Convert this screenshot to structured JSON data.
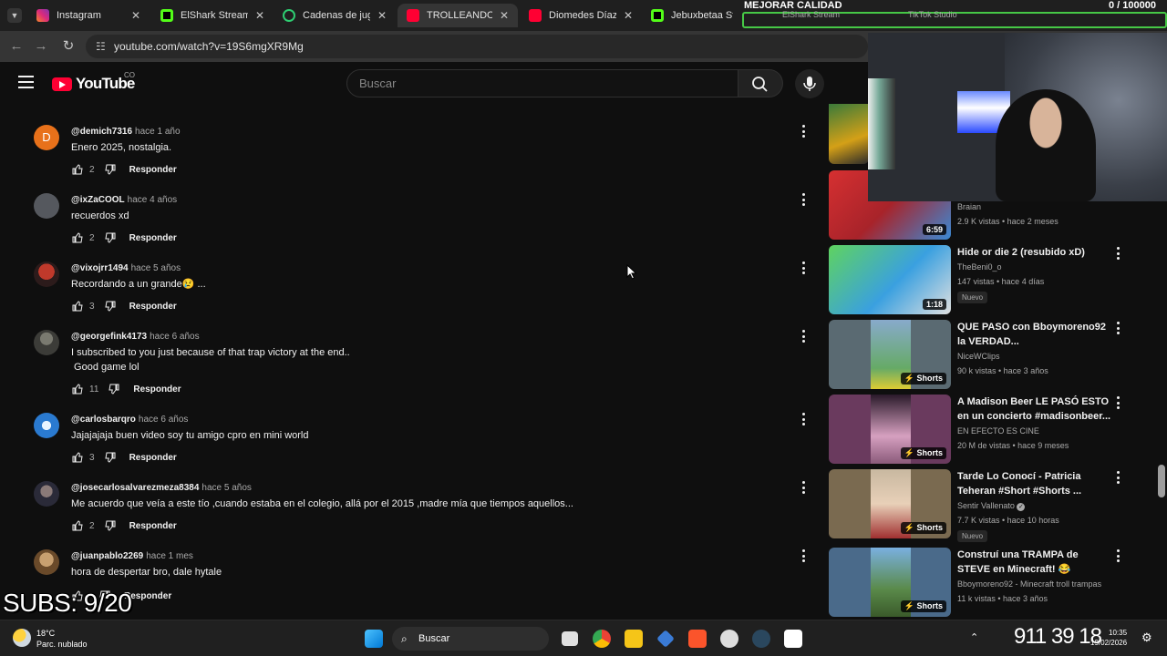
{
  "browser": {
    "tabs": [
      {
        "label": "Instagram",
        "color": "#d62976",
        "active": false
      },
      {
        "label": "ElShark Stream - V",
        "color": "#53fc18",
        "active": false
      },
      {
        "label": "Cadenas de jugad",
        "color": "#2ecc71",
        "active": false
      },
      {
        "label": "TROLLEANDO AF",
        "color": "#ff0033",
        "active": true
      },
      {
        "label": "Diomedes Díaz - T",
        "color": "#ff0033",
        "active": false
      },
      {
        "label": "Jebuxbetaa Strean",
        "color": "#53fc18",
        "active": false
      }
    ],
    "url": "youtube.com/watch?v=19S6mgXR9Mg"
  },
  "youtube": {
    "logo_word": "YouTube",
    "country": "CO",
    "search_placeholder": "Buscar"
  },
  "comments": [
    {
      "handle": "@demich7316",
      "ago": "hace 1 año",
      "text": "Enero 2025, nostalgia.",
      "likes": "2",
      "avatar_letter": "D",
      "avatar_color": "#e8711a"
    },
    {
      "handle": "@ixZaCOOL",
      "ago": "hace 4 años",
      "text": "recuerdos xd",
      "likes": "2",
      "avatar_letter": "",
      "avatar_color": "#55585e"
    },
    {
      "handle": "@vixojrr1494",
      "ago": "hace 5 años",
      "text": "Recordando a un grande😢 ...",
      "likes": "3",
      "avatar_letter": "",
      "avatar_color": "#6b2a2a"
    },
    {
      "handle": "@georgefink4173",
      "ago": "hace 6 años",
      "text": "I subscribed to you just because of that trap victory at the end..\n Good game lol",
      "likes": "11",
      "avatar_letter": "",
      "avatar_color": "#4a4a44"
    },
    {
      "handle": "@carlosbarqro",
      "ago": "hace 6 años",
      "text": "Jajajajaja buen video soy tu amigo cpro en mini world",
      "likes": "3",
      "avatar_letter": "",
      "avatar_color": "#2a7ad0"
    },
    {
      "handle": "@josecarlosalvarezmeza8384",
      "ago": "hace 5 años",
      "text": "Me acuerdo que veía a este tío ,cuando estaba en el colegio, allá por el 2015 ,madre mía que tiempos aquellos...",
      "likes": "2",
      "avatar_letter": "",
      "avatar_color": "#3a3a48"
    },
    {
      "handle": "@juanpablo2269",
      "ago": "hace 1 mes",
      "text": "hora de despertar bro, dale hytale",
      "likes": "",
      "avatar_letter": "",
      "avatar_color": "#8a6a4a"
    }
  ],
  "reply_label": "Responder",
  "sidebar": [
    {
      "title": "",
      "channel": "Braian",
      "stats": "2.9 K vistas • hace 2 meses",
      "badge": "6:59",
      "is_new": false,
      "thumb_color": "#c0392b"
    },
    {
      "title": "Hide or die 2 (resubido xD)",
      "channel": "TheBeni0_o",
      "stats": "147 vistas • hace 4 días",
      "badge": "1:18",
      "is_new": true,
      "thumb_color": "#4cbb4c"
    },
    {
      "title": "QUE PASO con Bboymoreno92 la VERDAD...",
      "channel": "NiceWClips",
      "stats": "90 k vistas • hace 3 años",
      "badge": "Shorts",
      "is_new": false,
      "thumb_color": "#5a6a72"
    },
    {
      "title": "A Madison Beer LE PASÓ ESTO en un concierto #madisonbeer...",
      "channel": "EN EFECTO ES CINE",
      "stats": "20 M de vistas • hace 9 meses",
      "badge": "Shorts",
      "is_new": false,
      "thumb_color": "#6a3a5e"
    },
    {
      "title": "Tarde Lo Conocí - Patricia Teheran #Short #Shorts ...",
      "channel": "Sentir Vallenato",
      "stats": "7.7 K vistas • hace 10 horas",
      "badge": "Shorts",
      "is_new": true,
      "thumb_color": "#7a6a50"
    },
    {
      "title": "Construí una TRAMPA de STEVE en Minecraft! 😂",
      "channel": "Bboymoreno92 - Minecraft troll trampas",
      "stats": "11 k vistas • hace 3 años",
      "badge": "Shorts",
      "is_new": false,
      "thumb_color": "#4a6a8a"
    }
  ],
  "new_label": "Nuevo",
  "overlays": {
    "quality_label": "MEJORAR CALIDAD",
    "counter": "0 / 100000",
    "subs": "SUBS: 9/20",
    "mini_tabs": [
      "ElShark Stream",
      "TikTok Studio"
    ]
  },
  "taskbar": {
    "temperature": "18°C",
    "weather": "Parc. nublado",
    "search": "Buscar",
    "time": "10:35",
    "date": "19/02/2026",
    "clock_digits": "911 39 18"
  }
}
